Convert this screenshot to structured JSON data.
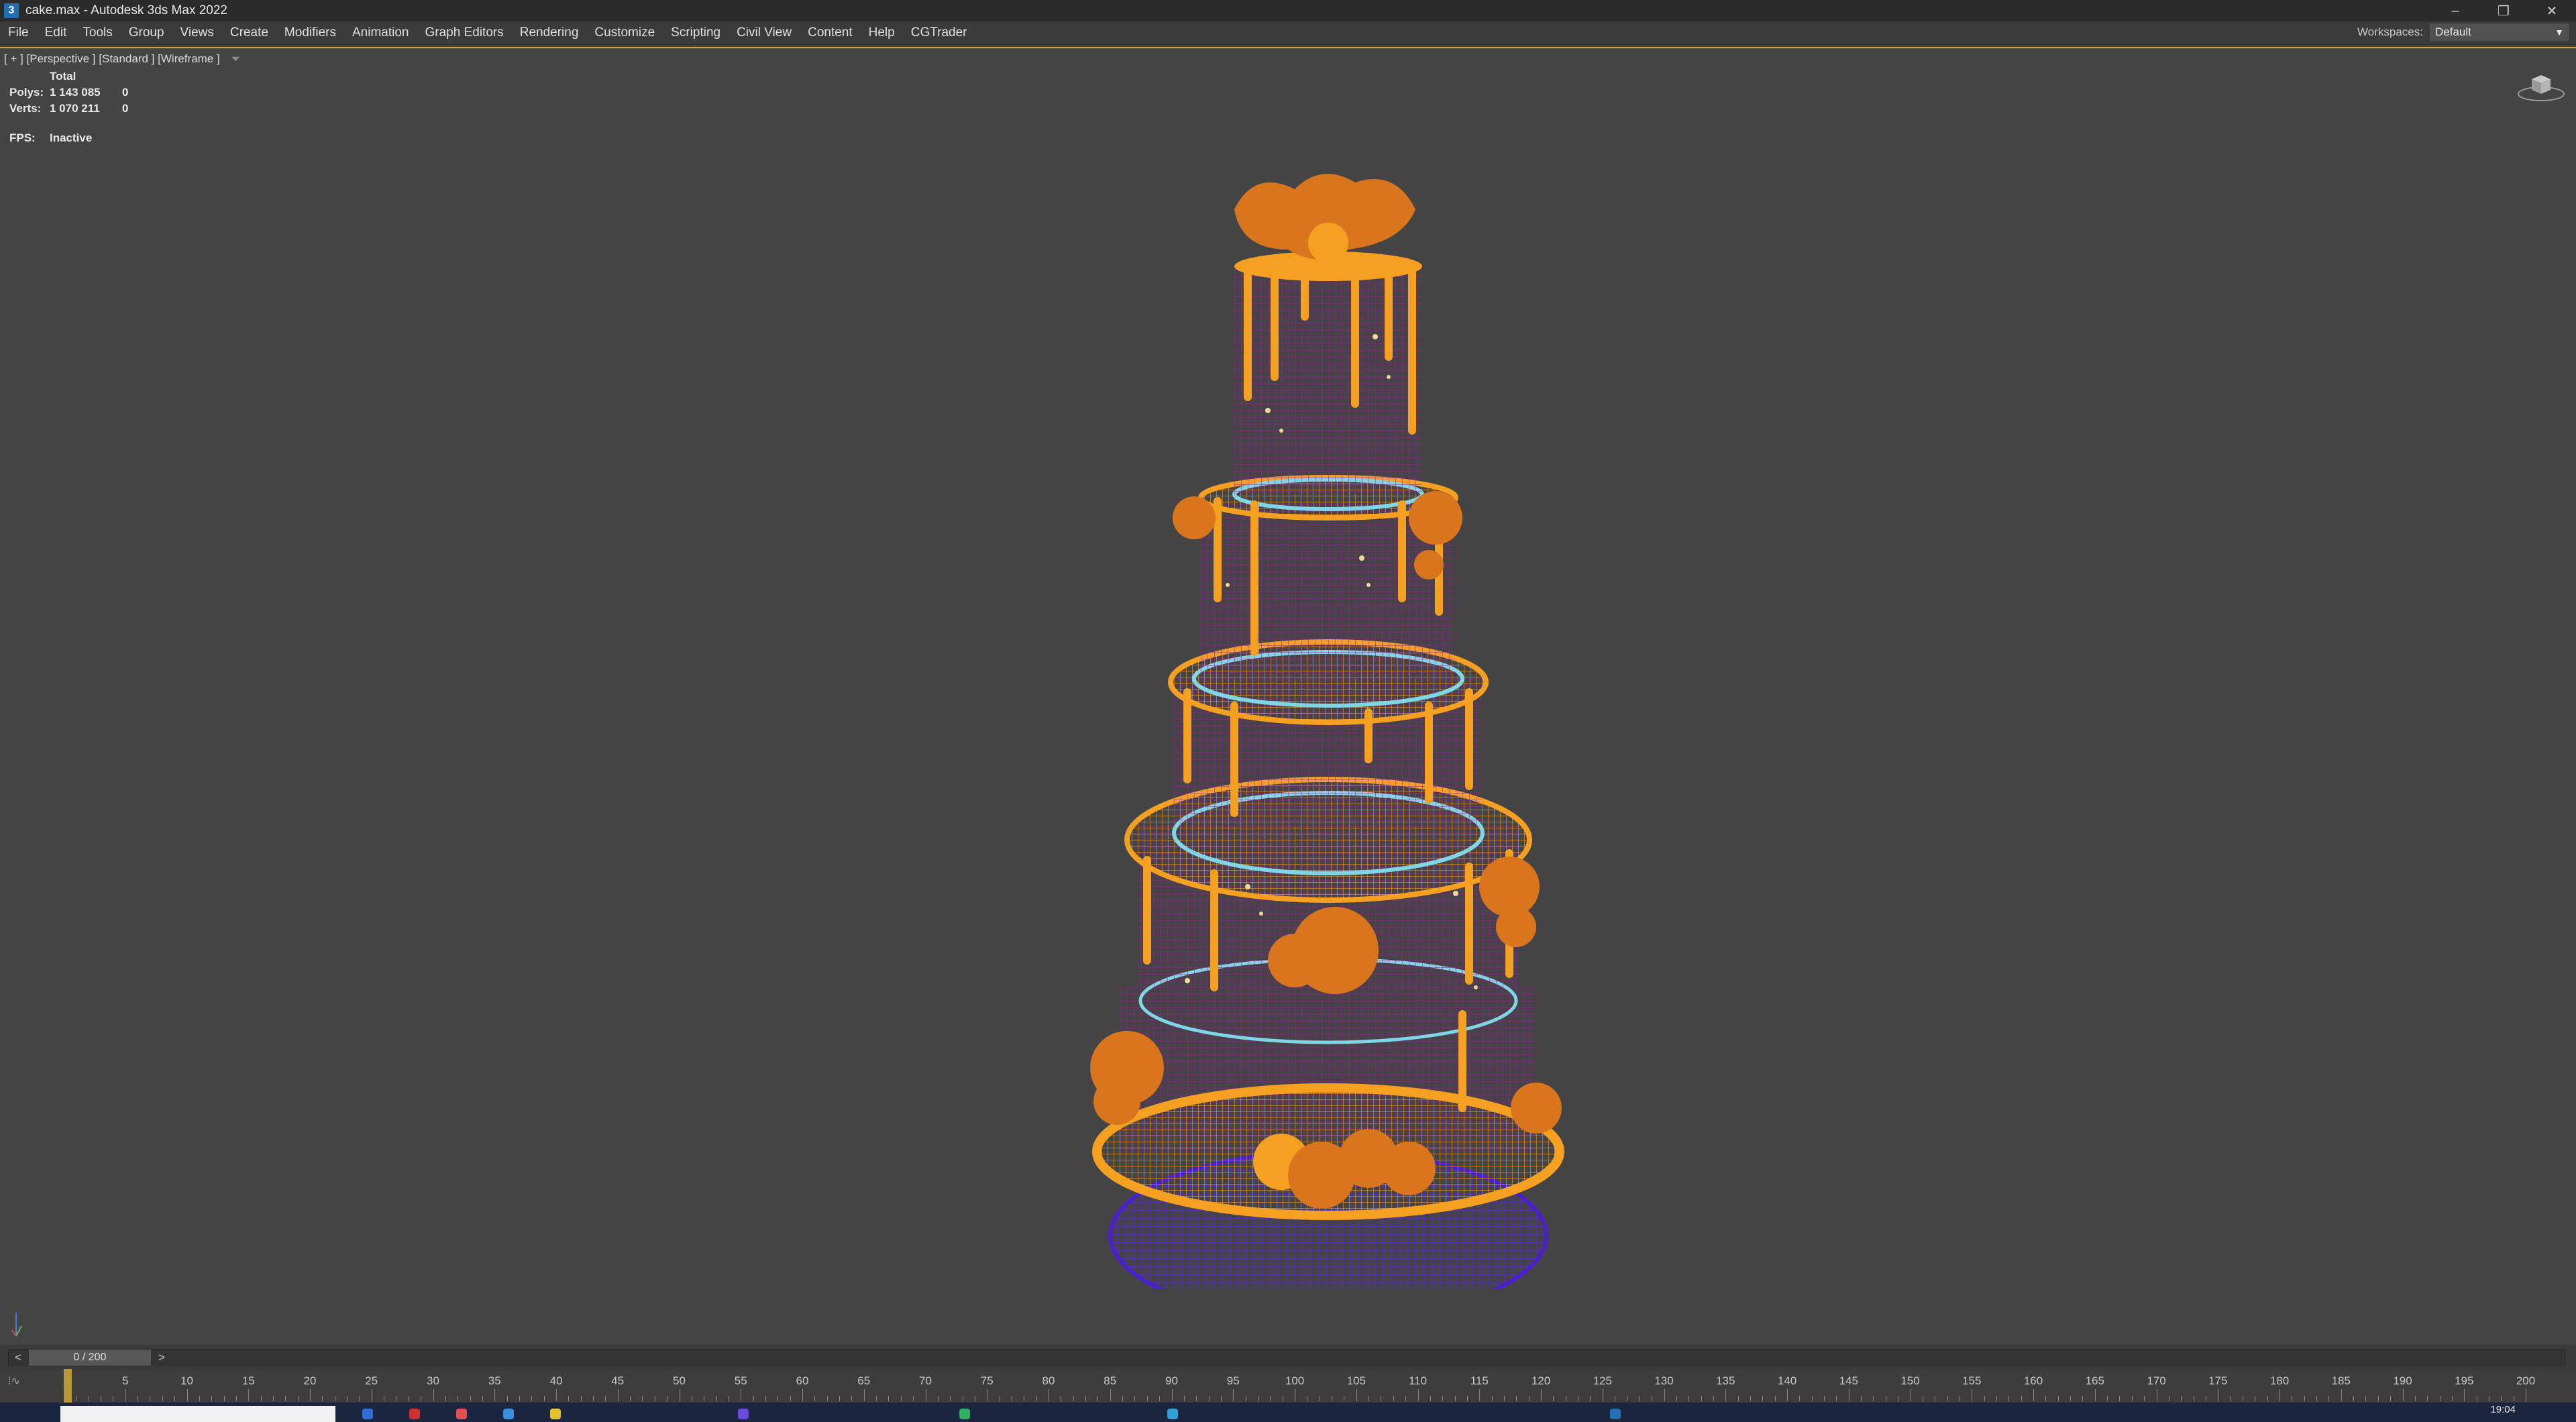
{
  "window": {
    "title": "cake.max - Autodesk 3ds Max 2022",
    "app_icon": "3",
    "minimize_glyph": "–",
    "restore_glyph": "❐",
    "close_glyph": "✕"
  },
  "menu": {
    "items": [
      "File",
      "Edit",
      "Tools",
      "Group",
      "Views",
      "Create",
      "Modifiers",
      "Animation",
      "Graph Editors",
      "Rendering",
      "Customize",
      "Scripting",
      "Civil View",
      "Content",
      "Help",
      "CGTrader"
    ],
    "workspaces_label": "Workspaces:",
    "workspaces_value": "Default"
  },
  "viewport": {
    "label": "[ + ] [Perspective ] [Standard ] [Wireframe ]",
    "filter_icon": "funnel-icon",
    "stats": {
      "header": "Total",
      "polys_label": "Polys:",
      "polys_value": "1 143 085",
      "polys_selected": "0",
      "verts_label": "Verts:",
      "verts_value": "1 070 211",
      "verts_selected": "0",
      "fps_label": "FPS:",
      "fps_value": "Inactive"
    }
  },
  "timeslider": {
    "prev": "<",
    "next": ">",
    "position": "0 / 200",
    "current_frame": 0,
    "total_frames": 200
  },
  "trackbar": {
    "icon": "⁞∿",
    "tick_labels": [
      "5",
      "10",
      "15",
      "20",
      "25",
      "30",
      "35",
      "40",
      "45",
      "50",
      "55",
      "60",
      "65",
      "70",
      "75",
      "80",
      "85",
      "90",
      "95",
      "100",
      "105",
      "110",
      "115",
      "120",
      "125",
      "130",
      "135",
      "140",
      "145",
      "150",
      "155",
      "160",
      "165",
      "170",
      "175",
      "180",
      "185",
      "190",
      "195",
      "200"
    ]
  },
  "taskbar": {
    "clock": "19:04"
  },
  "colors": {
    "viewport_bg": "#444444",
    "wire_orange": "#f5a020",
    "wire_purple": "#8a2a8a",
    "wire_blue": "#4a1fd0",
    "ring_cyan": "#7fd6e6",
    "active_border": "#c8a23a"
  }
}
